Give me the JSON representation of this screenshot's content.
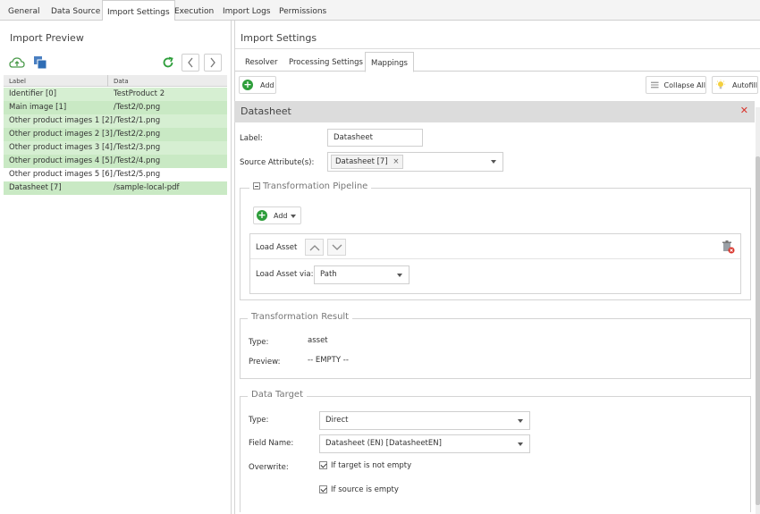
{
  "top_tabs": [
    "General",
    "Data Source",
    "Import Settings",
    "Execution",
    "Import Logs",
    "Permissions"
  ],
  "left": {
    "title": "Import Preview",
    "columns": [
      "Label",
      "Data"
    ],
    "rows": [
      {
        "label": "Identifier [0]",
        "data": "TestProduct 2"
      },
      {
        "label": "Main image [1]",
        "data": "/Test2/0.png"
      },
      {
        "label": "Other product images 1 [2]",
        "data": "/Test2/1.png"
      },
      {
        "label": "Other product images 2 [3]",
        "data": "/Test2/2.png"
      },
      {
        "label": "Other product images 3 [4]",
        "data": "/Test2/3.png"
      },
      {
        "label": "Other product images 4 [5]",
        "data": "/Test2/4.png"
      },
      {
        "label": "Other product images 5 [6]",
        "data": "/Test2/5.png"
      },
      {
        "label": "Datasheet [7]",
        "data": "/sample-local-pdf"
      }
    ]
  },
  "right": {
    "title": "Import Settings",
    "sub_tabs": [
      "Resolver",
      "Processing Settings",
      "Mappings"
    ],
    "toolbar": {
      "add": "Add",
      "collapse_all": "Collapse All",
      "autofill": "Autofill"
    },
    "section": {
      "title": "Datasheet",
      "label_field": "Label:",
      "label_value": "Datasheet",
      "source_field": "Source Attribute(s):",
      "source_tag": "Datasheet [7]",
      "pipeline": {
        "title": "Transformation Pipeline",
        "add": "Add",
        "step_name": "Load Asset",
        "via_label": "Load Asset via:",
        "via_value": "Path"
      },
      "result": {
        "title": "Transformation Result",
        "type_label": "Type:",
        "type_value": "asset",
        "preview_label": "Preview:",
        "preview_value": "-- EMPTY --"
      },
      "target": {
        "title": "Data Target",
        "type_label": "Type:",
        "type_value": "Direct",
        "field_label": "Field Name:",
        "field_value": "Datasheet (EN) [DatasheetEN]",
        "overwrite_label": "Overwrite:",
        "opt1": "If target is not empty",
        "opt2": "If source is empty"
      }
    }
  }
}
